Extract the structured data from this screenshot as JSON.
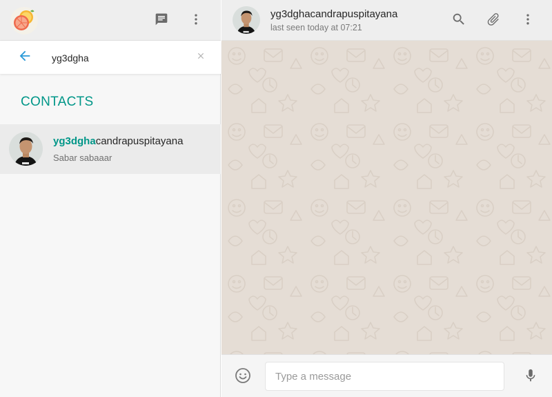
{
  "sidebar": {
    "header": {
      "my_avatar_icon": "citrus-avatar",
      "new_chat_icon": "chat-icon",
      "menu_icon": "more-vert-icon"
    },
    "search": {
      "value": "yg3dgha",
      "back_icon": "arrow-back-icon",
      "clear_icon": "close-icon"
    },
    "section_label": "CONTACTS",
    "contacts": [
      {
        "name_match": "yg3dgha",
        "name_rest": "candrapuspitayana",
        "status": "Sabar sabaaar",
        "avatar": "person-photo"
      }
    ]
  },
  "chat": {
    "header": {
      "name": "yg3dghacandrapuspitayana",
      "last_seen": "last seen today at 07:21",
      "icons": [
        "search-icon",
        "attach-icon",
        "more-vert-icon"
      ]
    },
    "composer": {
      "placeholder": "Type a message",
      "emoji_icon": "emoji-icon",
      "mic_icon": "mic-icon"
    }
  },
  "colors": {
    "accent": "#009688",
    "back_arrow": "#2a9ad8",
    "chat_bg": "#e5ddd5",
    "header_bg": "#eeeeee",
    "selected_row": "#ebebeb"
  }
}
